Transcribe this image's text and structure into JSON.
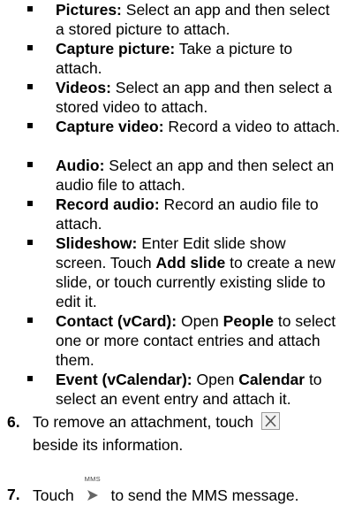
{
  "bullets": [
    {
      "term": "Pictures:",
      "parts": [
        "Select an app and then select a stored picture to attach."
      ]
    },
    {
      "term": "Capture picture:",
      "parts": [
        "Take a picture to attach."
      ]
    },
    {
      "term": "Videos:",
      "parts": [
        "Select an app and then select a stored video to attach."
      ]
    },
    {
      "term": "Capture video:",
      "parts": [
        "Record a video to attach."
      ]
    },
    {
      "term": "Audio:",
      "parts": [
        "Select an app and then select an audio file to attach."
      ]
    },
    {
      "term": "Record audio:",
      "parts": [
        "Record an audio file to attach."
      ]
    },
    {
      "term": "Slideshow:",
      "parts": [
        "Enter Edit slide show screen. Touch ",
        "Add slide",
        " to create a new slide, or touch currently existing slide to edit it."
      ]
    },
    {
      "term": "Contact (vCard):",
      "parts": [
        "Open ",
        "People",
        " to select one or more contact entries and attach them."
      ]
    },
    {
      "term": "Event (vCalendar):",
      "parts": [
        "Open ",
        "Calendar",
        " to select an event entry and attach it."
      ]
    }
  ],
  "steps": [
    {
      "number": "6.",
      "text_before": "To remove an attachment, touch",
      "text_after": "beside its information.",
      "icon": "close-x-icon"
    },
    {
      "number": "7.",
      "text_before": "Touch",
      "text_after": "to send the MMS message.",
      "icon": "send-mms-icon",
      "icon_caption": "MMS"
    }
  ]
}
